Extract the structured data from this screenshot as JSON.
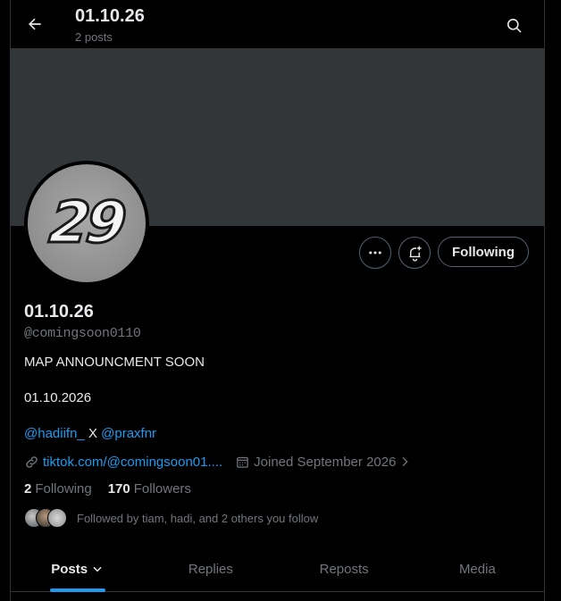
{
  "header": {
    "title": "01.10.26",
    "post_count": "2 posts"
  },
  "avatar": {
    "text": "29"
  },
  "actions": {
    "following_label": "Following"
  },
  "profile": {
    "name": "01.10.26",
    "handle": "@comingsoon0110",
    "bio_line1": "MAP ANNOUNCMENT SOON",
    "bio_line2": "01.10.2026",
    "mention1": "@hadiifn_",
    "separator": " X ",
    "mention2": "@praxfnr",
    "website": "tiktok.com/@comingsoon01....",
    "joined": "Joined September 2026"
  },
  "stats": {
    "following_count": "2",
    "following_label": "Following",
    "followers_count": "170",
    "followers_label": "Followers"
  },
  "followed_by": "Followed by tiam, hadi, and 2 others you follow",
  "tabs": [
    {
      "label": "Posts"
    },
    {
      "label": "Replies"
    },
    {
      "label": "Reposts"
    },
    {
      "label": "Media"
    }
  ],
  "colors": {
    "accent": "#1d9bf0",
    "banner": "#333639",
    "muted": "#71767b"
  }
}
